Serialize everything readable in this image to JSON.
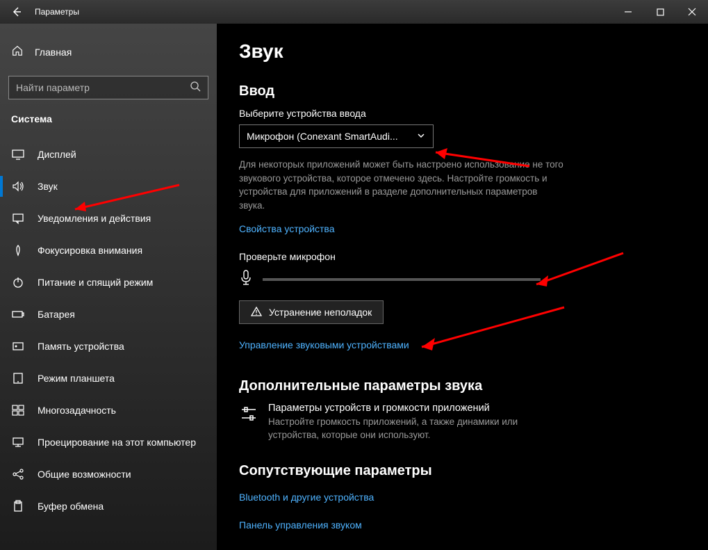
{
  "titlebar": {
    "title": "Параметры"
  },
  "sidebar": {
    "home": "Главная",
    "search_placeholder": "Найти параметр",
    "category": "Система",
    "items": [
      {
        "id": "display",
        "label": "Дисплей"
      },
      {
        "id": "sound",
        "label": "Звук",
        "selected": true
      },
      {
        "id": "notifications",
        "label": "Уведомления и действия"
      },
      {
        "id": "focus",
        "label": "Фокусировка внимания"
      },
      {
        "id": "power",
        "label": "Питание и спящий режим"
      },
      {
        "id": "battery",
        "label": "Батарея"
      },
      {
        "id": "storage",
        "label": "Память устройства"
      },
      {
        "id": "tablet",
        "label": "Режим планшета"
      },
      {
        "id": "multitask",
        "label": "Многозадачность"
      },
      {
        "id": "project",
        "label": "Проецирование на этот компьютер"
      },
      {
        "id": "shared",
        "label": "Общие возможности"
      },
      {
        "id": "clipboard",
        "label": "Буфер обмена"
      }
    ]
  },
  "content": {
    "page_title": "Звук",
    "input_heading": "Ввод",
    "choose_input_label": "Выберите устройства ввода",
    "input_device_value": "Микрофон (Conexant SmartAudi...",
    "input_helptext": "Для некоторых приложений может быть настроено использование не того звукового устройства, которое отмечено здесь. Настройте громкость и устройства для приложений в разделе дополнительных параметров звука.",
    "device_props_link": "Свойства устройства",
    "test_mic_label": "Проверьте микрофон",
    "troubleshoot_btn": "Устранение неполадок",
    "manage_devices_link": "Управление звуковыми устройствами",
    "advanced_heading": "Дополнительные параметры звука",
    "advanced_item_title": "Параметры устройств и громкости приложений",
    "advanced_item_desc": "Настройте громкость приложений, а также динамики или устройства, которые они используют.",
    "related_heading": "Сопутствующие параметры",
    "related_link1": "Bluetooth и другие устройства",
    "related_link2": "Панель управления звуком"
  }
}
